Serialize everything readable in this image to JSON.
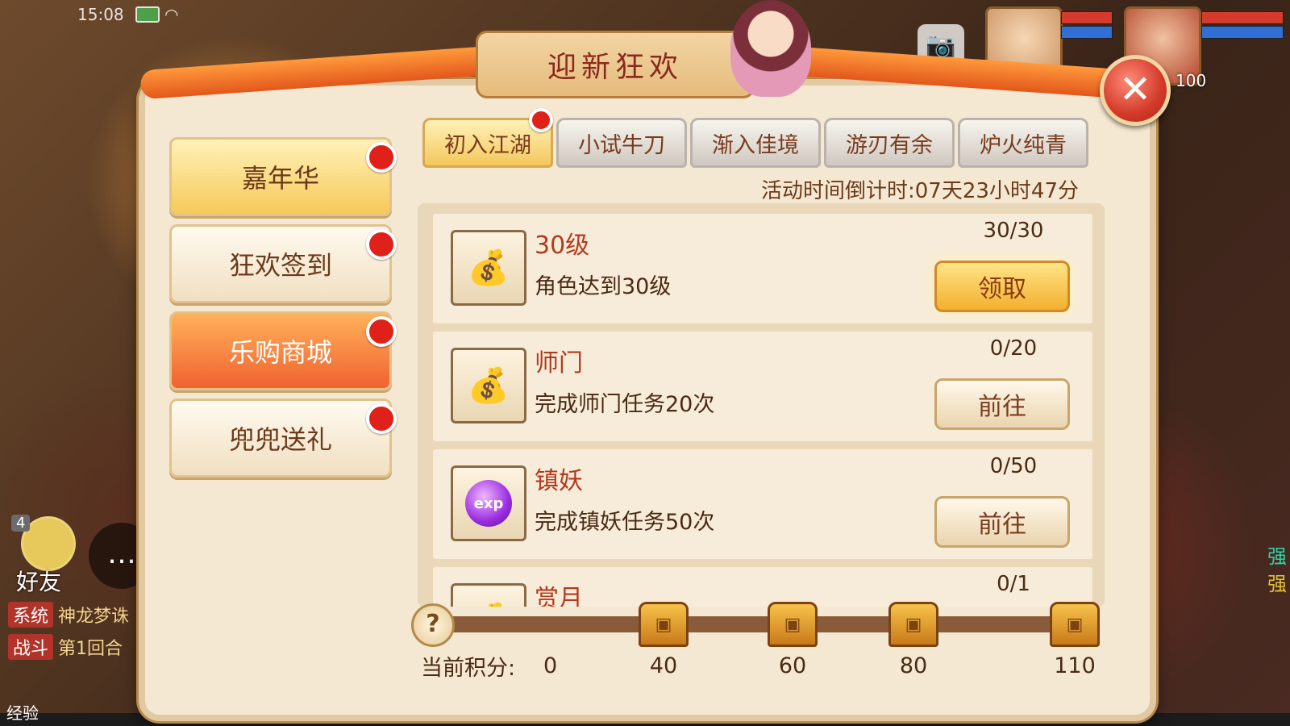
{
  "status_bar": {
    "time": "15:08"
  },
  "hud": {
    "portrait_level": "100",
    "friends_badge": "4",
    "friends_label": "好友",
    "chat": [
      {
        "tag": "系统",
        "text": "神龙梦诛"
      },
      {
        "tag": "战斗",
        "text": "第1回合"
      }
    ],
    "exp_label": "经验",
    "right_hints": [
      "强",
      "强"
    ]
  },
  "window": {
    "title": "迎新狂欢",
    "close_symbol": "✕"
  },
  "sidebar": {
    "items": [
      {
        "label": "嘉年华",
        "style": "gold",
        "has_dot": true
      },
      {
        "label": "狂欢签到",
        "style": "normal",
        "has_dot": true
      },
      {
        "label": "乐购商城",
        "style": "orange",
        "has_dot": true
      },
      {
        "label": "兜兜送礼",
        "style": "normal",
        "has_dot": true
      }
    ]
  },
  "tabs": [
    {
      "label": "初入江湖",
      "active": true,
      "has_dot": true
    },
    {
      "label": "小试牛刀",
      "active": false
    },
    {
      "label": "渐入佳境",
      "active": false
    },
    {
      "label": "游刃有余",
      "active": false
    },
    {
      "label": "炉火纯青",
      "active": false
    }
  ],
  "countdown": "活动时间倒计时:07天23小时47分",
  "tasks": [
    {
      "title": "30级",
      "desc": "角色达到30级",
      "progress": "30/30",
      "button": "领取",
      "claimable": true,
      "icon": "money-bag-icon"
    },
    {
      "title": "师门",
      "desc": "完成师门任务20次",
      "progress": "0/20",
      "button": "前往",
      "claimable": false,
      "icon": "money-bag-icon"
    },
    {
      "title": "镇妖",
      "desc": "完成镇妖任务50次",
      "progress": "0/50",
      "button": "前往",
      "claimable": false,
      "icon": "exp-orb-icon",
      "icon_text": "exp"
    },
    {
      "title": "赏月",
      "desc": "",
      "progress": "0/1",
      "button": "",
      "claimable": false,
      "icon": "money-bag-icon"
    }
  ],
  "score": {
    "label": "当前积分:",
    "current": "0",
    "current_value": 0,
    "max_value": 110,
    "milestones": [
      "40",
      "60",
      "80",
      "110"
    ]
  },
  "colors": {
    "accent_red": "#b23a1d",
    "claim_gold": "#f2b02f",
    "panel_bg": "#f4e8d2"
  }
}
